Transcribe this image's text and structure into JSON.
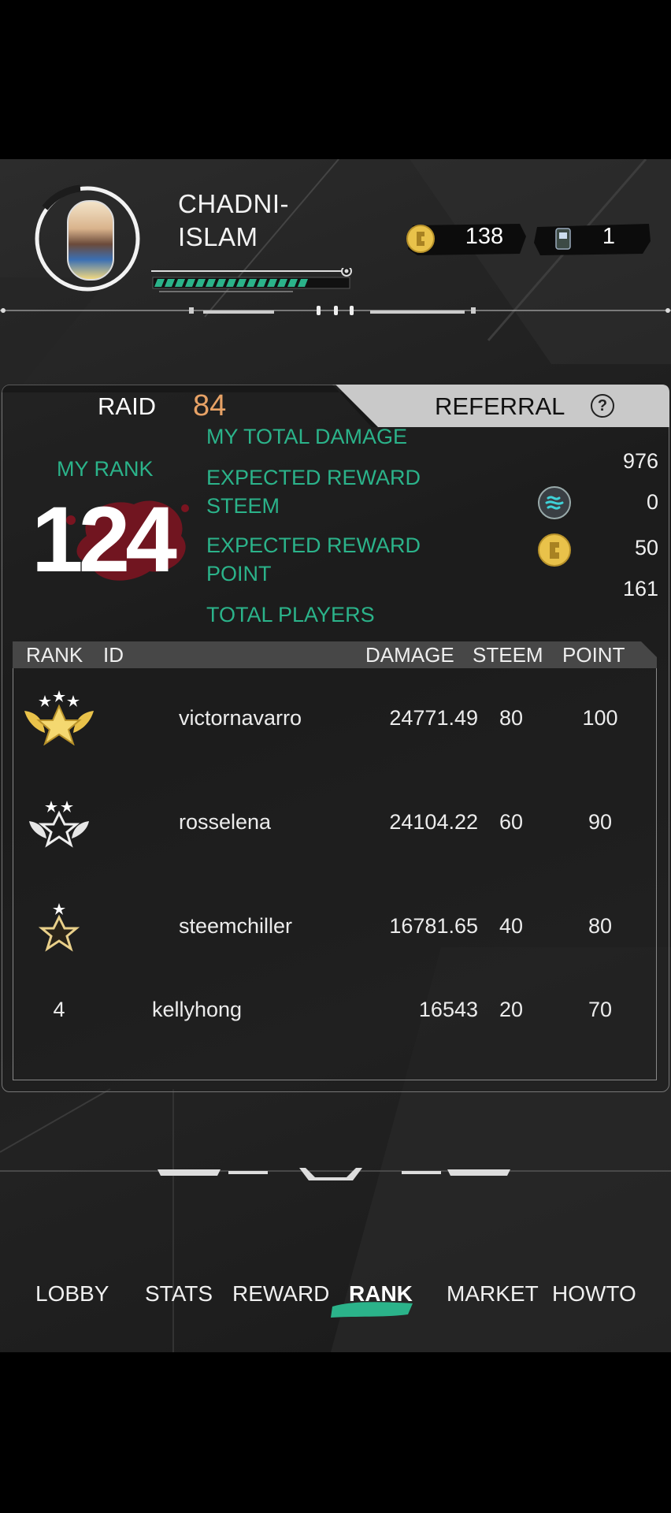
{
  "player": {
    "name_line1": "CHADNI-",
    "name_line2": "ISLAM",
    "xp_progress": 0.78
  },
  "currency": {
    "coins": "138",
    "tickets": "1"
  },
  "tabs": {
    "raid_label": "RAID",
    "raid_value": "84",
    "referral_label": "REFERRAL",
    "help": "?"
  },
  "my_rank": {
    "label": "MY RANK",
    "value": "124"
  },
  "stats": {
    "total_damage_label": "MY TOTAL DAMAGE",
    "expected_steem_label": "EXPECTED REWARD STEEM",
    "expected_point_label": "EXPECTED REWARD POINT",
    "total_players_label": "TOTAL PLAYERS",
    "total_damage": "976",
    "expected_steem": "0",
    "expected_point": "50",
    "total_players": "161"
  },
  "table": {
    "headers": {
      "rank": "RANK",
      "id": "ID",
      "damage": "DAMAGE",
      "steem": "STEEM",
      "point": "POINT"
    },
    "rows": [
      {
        "rank": "1",
        "id": "victornavarro",
        "damage": "24771.49",
        "steem": "80",
        "point": "100"
      },
      {
        "rank": "2",
        "id": "rosselena",
        "damage": "24104.22",
        "steem": "60",
        "point": "90"
      },
      {
        "rank": "3",
        "id": "steemchiller",
        "damage": "16781.65",
        "steem": "40",
        "point": "80"
      },
      {
        "rank": "4",
        "id": "kellyhong",
        "damage": "16543",
        "steem": "20",
        "point": "70"
      }
    ]
  },
  "nav": {
    "lobby": "LOBBY",
    "stats": "STATS",
    "reward": "REWARD",
    "rank": "RANK",
    "market": "MARKET",
    "howto": "HOWTO"
  },
  "colors": {
    "teal": "#2bb38a",
    "raid_orange": "#e7a266",
    "gold": "#e9c24a",
    "blood": "#7a1420"
  }
}
